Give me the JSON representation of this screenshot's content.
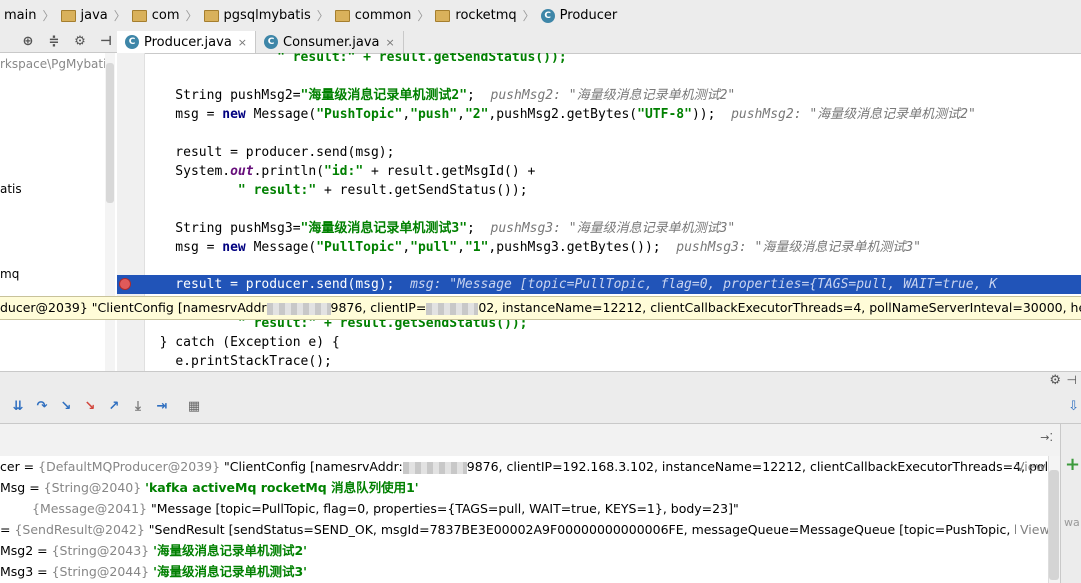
{
  "breadcrumb": [
    "main",
    "java",
    "com",
    "pgsqlmybatis",
    "common",
    "rocketmq",
    "Producer"
  ],
  "editor": {
    "tabs": [
      {
        "label": "Producer.java",
        "close": "×"
      },
      {
        "label": "Consumer.java",
        "close": "×"
      }
    ]
  },
  "project": {
    "path_fragment": "rkspace\\PgMybati",
    "row_atis": "atis",
    "row_mq": "mq"
  },
  "code": {
    "line1_tail": "\" result:\" + result.getSendStatus());",
    "hint_pushMsg2": "pushMsg2: \"海量级消息记录单机测试2\"",
    "hint_msg2": "pushMsg2: \"海量级消息记录单机测试2\"",
    "hint_pushMsg3": "pushMsg3: \"海量级消息记录单机测试3\"",
    "hint_msg3": "pushMsg3: \"海量级消息记录单机测试3\"",
    "hint_result": "msg: \"Message [topic=PullTopic, flag=0, properties={TAGS=pull, WAIT=true, K",
    "line_result2_tail": "\" result:\" + result.getSendStatus());",
    "catch_line": "} catch (Exception e) {",
    "print_line": "e.printStackTrace();"
  },
  "tooltip": {
    "prefix": "ducer@2039} \"ClientConfig [namesrvAddr",
    "mid1": "9876, clientIP=",
    "mid2": "02, instanceName=12212, clientCallbackExecutorThreads=4, pollNameServerInteval=30000, heartbeatB"
  },
  "variables": [
    {
      "name": "cer",
      "type": "{DefaultMQProducer@2039}",
      "value_a": "\"ClientConfig [namesrvAddr:",
      "value_b": "9876, clientIP=192.168.3.102, instanceName=12212, clientCallbackExecutorThreads=4, pollNar...",
      "view": "View"
    },
    {
      "name": "Msg",
      "type": "{String@2040}",
      "value": "'kafka activeMq rocketMq 消息队列使用1'"
    },
    {
      "name": "",
      "type": "{Message@2041}",
      "value": "\"Message [topic=PullTopic, flag=0, properties={TAGS=pull, WAIT=true, KEYS=1}, body=23]\""
    },
    {
      "name": "",
      "type": "{SendResult@2042}",
      "value": "\"SendResult [sendStatus=SEND_OK, msgId=7837BE3E00002A9F00000000000006FE, messageQueue=MessageQueue [topic=PushTopic, brokerName=...",
      "view": "View"
    },
    {
      "name": "Msg2",
      "type": "{String@2043}",
      "value": "'海量级消息记录单机测试2'"
    },
    {
      "name": "Msg3",
      "type": "{String@2044}",
      "value": "'海量级消息记录单机测试3'"
    }
  ],
  "side_text": "wa"
}
